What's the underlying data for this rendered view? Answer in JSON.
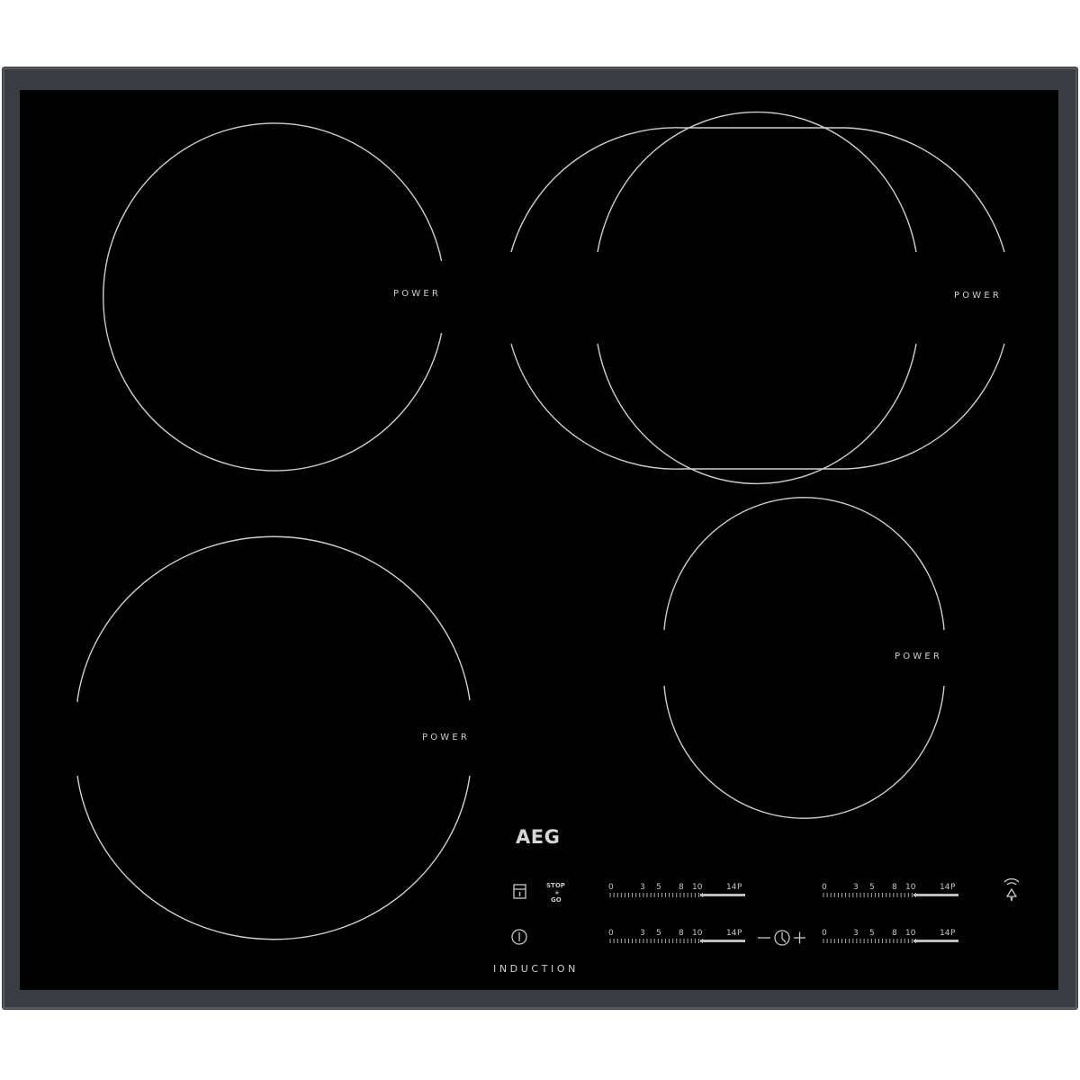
{
  "zones": {
    "rear_left": {
      "label": "POWER"
    },
    "rear_right": {
      "label": "POWER"
    },
    "front_left": {
      "label": "POWER"
    },
    "front_right": {
      "label": "POWER"
    }
  },
  "brand": "AEG",
  "technology_label": "INDUCTION",
  "controls": {
    "stop_go": {
      "line1": "STOP",
      "line2": "+",
      "line3": "GO"
    },
    "sliders": [
      {
        "name": "slider-rear-left",
        "ticks": [
          "0",
          "3",
          "5",
          "8",
          "10",
          "14",
          "P"
        ]
      },
      {
        "name": "slider-rear-right",
        "ticks": [
          "0",
          "3",
          "5",
          "8",
          "10",
          "14",
          "P"
        ]
      },
      {
        "name": "slider-front-left",
        "ticks": [
          "0",
          "3",
          "5",
          "8",
          "10",
          "14",
          "P"
        ]
      },
      {
        "name": "slider-front-right",
        "ticks": [
          "0",
          "3",
          "5",
          "8",
          "10",
          "14",
          "P"
        ]
      }
    ],
    "icons": {
      "lock": "lock-icon",
      "power": "power-icon",
      "timer": "timer-icon",
      "hob2hood": "hob2hood-icon"
    }
  },
  "colors": {
    "glass": "#000000",
    "frame": "#3a3d42",
    "markings": "#cfcfcf"
  }
}
